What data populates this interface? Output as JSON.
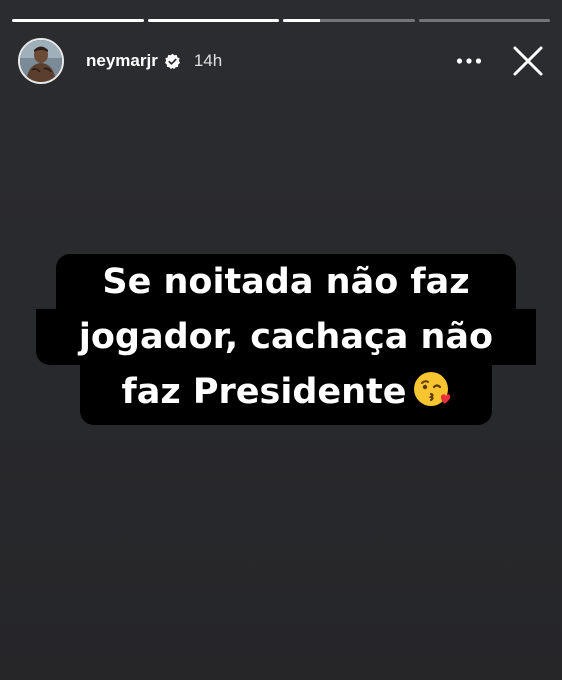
{
  "story": {
    "progress": [
      1,
      1,
      0.28,
      0
    ],
    "user": {
      "username": "neymarjr",
      "verified": true,
      "time_ago": "14h",
      "avatar": "profile-photo"
    },
    "actions": {
      "more_icon": "more-horizontal-icon",
      "close_icon": "close-icon"
    },
    "caption": {
      "line1": "Se noitada não faz",
      "line2": "jogador, cachaça não",
      "line3": "faz Presidente",
      "emoji": "face-blowing-a-kiss"
    }
  }
}
